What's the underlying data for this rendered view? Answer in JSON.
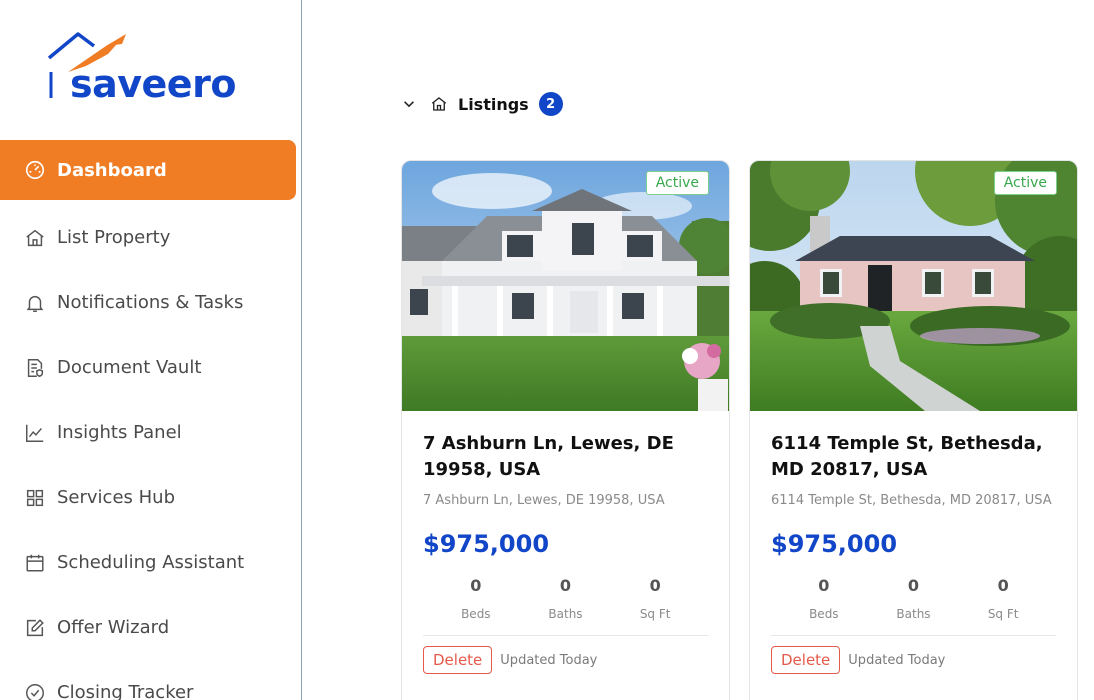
{
  "brand": {
    "name": "saveero",
    "primary": "#1246c8",
    "accent": "#f07c24"
  },
  "sidebar": {
    "items": [
      {
        "label": "Dashboard",
        "icon": "dashboard-gauge-icon",
        "active": true
      },
      {
        "label": "List Property",
        "icon": "home-icon"
      },
      {
        "label": "Notifications & Tasks",
        "icon": "bell-icon"
      },
      {
        "label": "Document Vault",
        "icon": "document-shield-icon"
      },
      {
        "label": "Insights Panel",
        "icon": "line-chart-icon"
      },
      {
        "label": "Services Hub",
        "icon": "grid-icon"
      },
      {
        "label": "Scheduling Assistant",
        "icon": "calendar-icon"
      },
      {
        "label": "Offer Wizard",
        "icon": "edit-icon"
      },
      {
        "label": "Closing Tracker",
        "icon": "check-circle-icon"
      }
    ]
  },
  "listings": {
    "title": "Listings",
    "count": "2",
    "cards": [
      {
        "status": "Active",
        "title": "7 Ashburn Ln, Lewes, DE 19958, USA",
        "address": "7 Ashburn Ln, Lewes, DE 19958, USA",
        "price": "$975,000",
        "beds": "0",
        "beds_label": "Beds",
        "baths": "0",
        "baths_label": "Baths",
        "sqft": "0",
        "sqft_label": "Sq Ft",
        "delete_label": "Delete",
        "updated": "Updated Today"
      },
      {
        "status": "Active",
        "title": "6114 Temple St, Bethesda, MD 20817, USA",
        "address": "6114 Temple St, Bethesda, MD 20817, USA",
        "price": "$975,000",
        "beds": "0",
        "beds_label": "Beds",
        "baths": "0",
        "baths_label": "Baths",
        "sqft": "0",
        "sqft_label": "Sq Ft",
        "delete_label": "Delete",
        "updated": "Updated Today"
      }
    ]
  }
}
